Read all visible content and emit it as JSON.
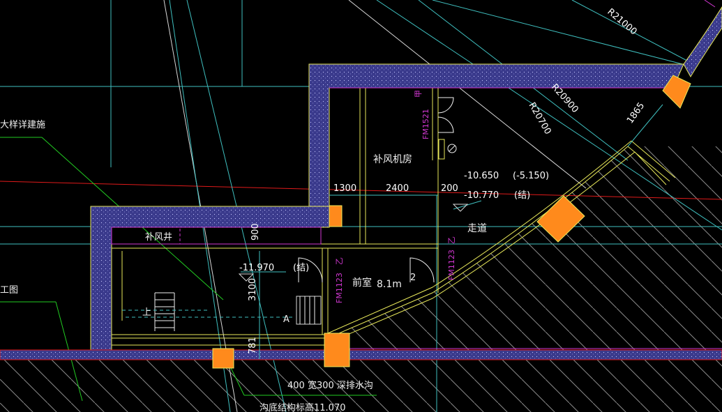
{
  "colors": {
    "background": "#000000",
    "wall_fill": "#3a3a8c",
    "wall_edge": "#e8e85a",
    "column": "#ff8a1c",
    "grid_cyan": "#3fbfbf",
    "red_line": "#e01a1a",
    "green_leader": "#22cc22",
    "magenta_text": "#d238d2",
    "hatch": "#9a9a9a"
  },
  "labels": {
    "detail_ref": "大样详建施",
    "construction_drawing": "工图",
    "supply_air_room": "补风机房",
    "supply_air_shaft": "补风井",
    "corridor": "走道",
    "anteroom": "前室",
    "anteroom_area": "8.1m",
    "area_sup": "2",
    "drain": "400   宽300   深排水沟",
    "trench_bottom": "沟底结构标高11.070",
    "up_arrow": "上",
    "section_a": "A"
  },
  "dimensions": {
    "d1300": "1300",
    "d2400": "2400",
    "d200": "200",
    "d900": "900",
    "d3100": "3100",
    "d781": "781",
    "d1865": "1865"
  },
  "elevations": {
    "e1": "-10.650",
    "e2": "(-5.150)",
    "e3": "-10.770",
    "e4": "(结)",
    "e5": "-11.970",
    "e6": "(结)"
  },
  "radii": {
    "r21000": "R21000",
    "r20900": "R20900",
    "r20700": "R20700"
  },
  "doors": {
    "fm1521": "FM1521",
    "fm1521_class": "甲",
    "fm1123_a": "FM1123",
    "fm1123_a_class": "乙",
    "fm1123_b": "FM1123",
    "fm1123_b_class": "乙"
  }
}
